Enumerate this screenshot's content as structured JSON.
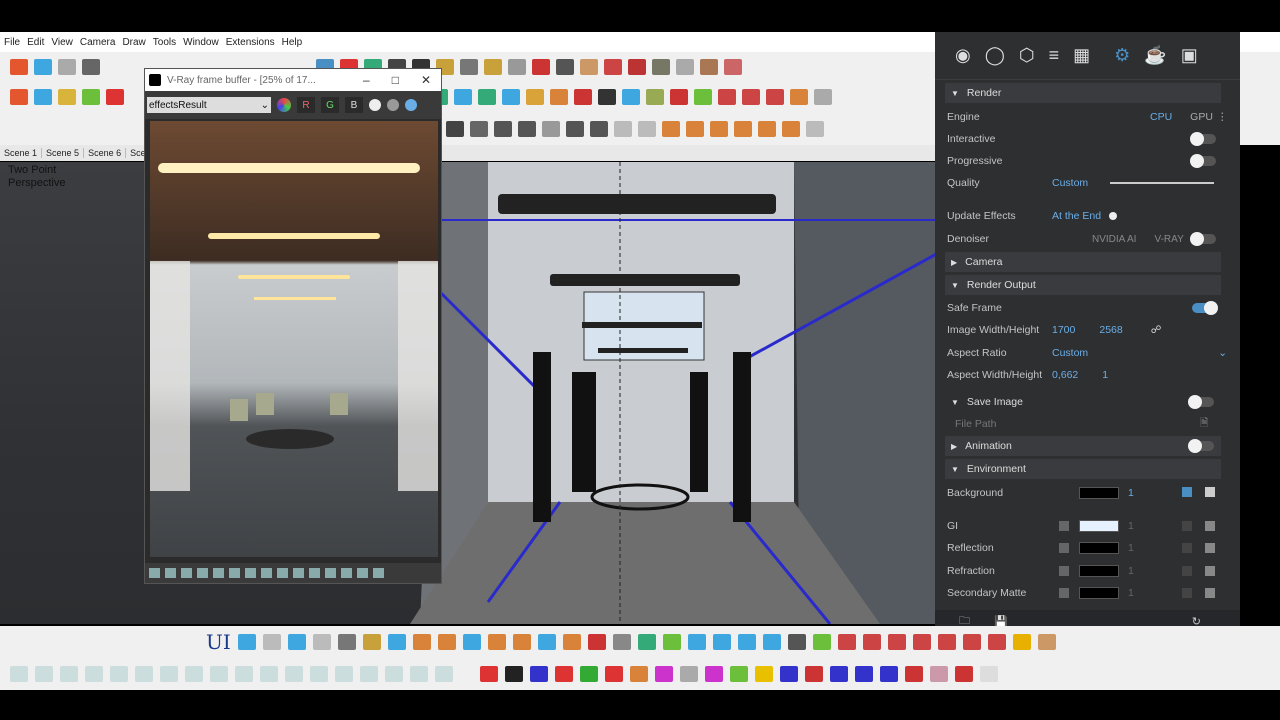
{
  "menu": [
    "File",
    "Edit",
    "View",
    "Camera",
    "Draw",
    "Tools",
    "Window",
    "Extensions",
    "Help"
  ],
  "scenes": [
    "Scene 1",
    "Scene 5",
    "Scene 6",
    "Sce"
  ],
  "viewport": {
    "label_line1": "Two Point",
    "label_line2": "Perspective"
  },
  "vfb": {
    "title": "V-Ray frame buffer - [25% of 17...",
    "channel_select": "effectsResult",
    "channels": [
      "R",
      "G",
      "B"
    ]
  },
  "panel": {
    "sections": {
      "render": "Render",
      "camera": "Camera",
      "render_output": "Render Output",
      "save_image": "Save Image",
      "animation": "Animation",
      "environment": "Environment"
    },
    "engine": {
      "label": "Engine",
      "cpu": "CPU",
      "gpu": "GPU"
    },
    "interactive": {
      "label": "Interactive"
    },
    "progressive": {
      "label": "Progressive"
    },
    "quality": {
      "label": "Quality",
      "value": "Custom"
    },
    "update_effects": {
      "label": "Update Effects",
      "value": "At the End"
    },
    "denoiser": {
      "label": "Denoiser",
      "nvidia": "NVIDIA AI",
      "vray": "V-RAY"
    },
    "safe_frame": {
      "label": "Safe Frame"
    },
    "image_wh": {
      "label": "Image Width/Height",
      "w": "1700",
      "h": "2568"
    },
    "aspect_ratio": {
      "label": "Aspect Ratio",
      "value": "Custom"
    },
    "aspect_wh": {
      "label": "Aspect Width/Height",
      "w": "0,662",
      "h": "1"
    },
    "file_path": {
      "label": "File Path"
    },
    "background": {
      "label": "Background",
      "value": "1"
    },
    "gi": {
      "label": "GI",
      "value": "1"
    },
    "reflection": {
      "label": "Reflection",
      "value": "1"
    },
    "refraction": {
      "label": "Refraction",
      "value": "1"
    },
    "secondary_matte": {
      "label": "Secondary Matte",
      "value": "1"
    }
  },
  "bottom_toolbar": {
    "ui_label": "UI"
  },
  "colors": {
    "accent": "#4a8fc4",
    "panel_bg": "#2e2f31",
    "value_blue": "#6aaee8"
  }
}
